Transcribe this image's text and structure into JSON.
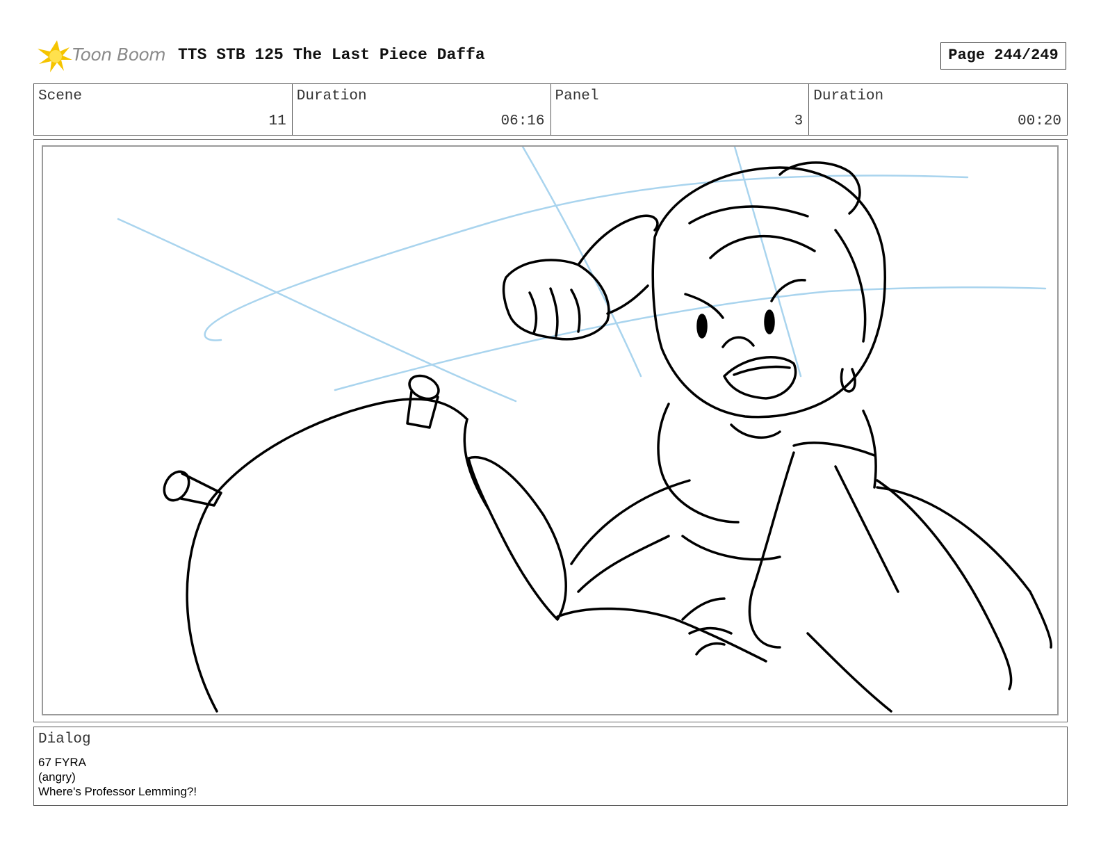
{
  "header": {
    "logo_text": "Toon Boom",
    "title": "TTS STB 125 The Last Piece Daffa",
    "page_label": "Page 244/249"
  },
  "info": {
    "scene_label": "Scene",
    "scene_value": "11",
    "scene_duration_label": "Duration",
    "scene_duration_value": "06:16",
    "panel_label": "Panel",
    "panel_value": "3",
    "panel_duration_label": "Duration",
    "panel_duration_value": "00:20"
  },
  "dialog": {
    "label": "Dialog",
    "lines": [
      "67 FYRA",
      "(angry)",
      "Where's Professor Lemming?!"
    ]
  },
  "colors": {
    "logo_yellow": "#f5c400",
    "sketch_blue": "#a9d4ee",
    "sketch_black": "#000000"
  }
}
